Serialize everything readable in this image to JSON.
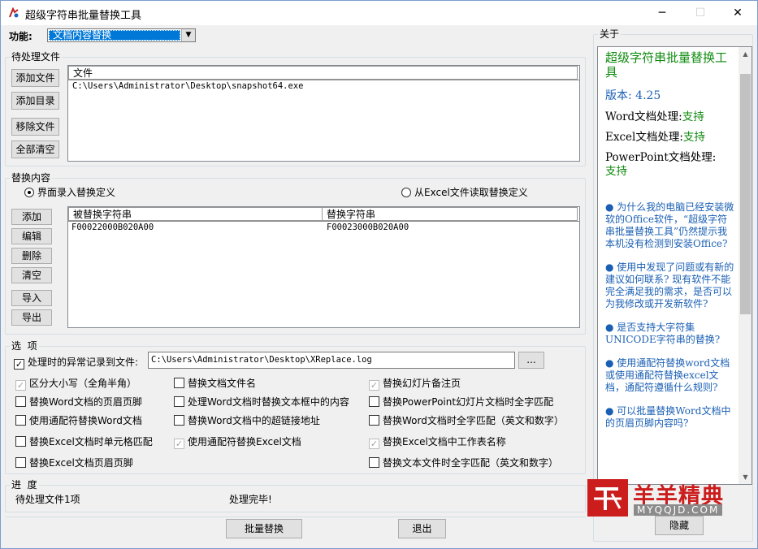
{
  "window": {
    "title": "超级字符串批量替换工具"
  },
  "function": {
    "label": "功能:",
    "selected": "文档内容替换"
  },
  "pending": {
    "group_label": "待处理文件",
    "buttons": [
      "添加文件",
      "添加目录",
      "移除文件",
      "全部清空"
    ],
    "column": "文件",
    "files": [
      "C:\\Users\\Administrator\\Desktop\\snapshot64.exe"
    ]
  },
  "replace": {
    "group_label": "替换内容",
    "radio_ui": "界面录入替换定义",
    "radio_excel": "从Excel文件读取替换定义",
    "buttons": [
      "添加",
      "编辑",
      "删除",
      "清空",
      "导入",
      "导出"
    ],
    "col_from": "被替换字符串",
    "col_to": "替换字符串",
    "rows": [
      {
        "from": "F00022000B020A00",
        "to": "F00023000B020A00"
      }
    ]
  },
  "options": {
    "group_label": "选  项",
    "log_label": "处理时的异常记录到文件:",
    "log_path": "C:\\Users\\Administrator\\Desktop\\XReplace.log",
    "browse": "...",
    "items": [
      {
        "label": "区分大小写（全角半角）",
        "checked": true,
        "disabled": true
      },
      {
        "label": "替换文档文件名",
        "checked": false,
        "disabled": false
      },
      {
        "label": "替换幻灯片备注页",
        "checked": true,
        "disabled": true
      },
      {
        "label": "替换Word文档的页眉页脚",
        "checked": false,
        "disabled": false
      },
      {
        "label": "处理Word文档时替换文本框中的内容",
        "checked": false,
        "disabled": false
      },
      {
        "label": "替换PowerPoint幻灯片文档时全字匹配",
        "checked": false,
        "disabled": false
      },
      {
        "label": "使用通配符替换Word文档",
        "checked": false,
        "disabled": false
      },
      {
        "label": "替换Word文档中的超链接地址",
        "checked": false,
        "disabled": false
      },
      {
        "label": "替换Word文档时全字匹配（英文和数字）",
        "checked": false,
        "disabled": false
      },
      {
        "label": "替换Excel文档时单元格匹配",
        "checked": false,
        "disabled": false
      },
      {
        "label": "使用通配符替换Excel文档",
        "checked": true,
        "disabled": true
      },
      {
        "label": "替换Excel文档中工作表名称",
        "checked": true,
        "disabled": true
      },
      {
        "label": "替换Excel文档页眉页脚",
        "checked": false,
        "disabled": false
      },
      {
        "label": "替换文本文件时全字匹配（英文和数字）",
        "checked": false,
        "disabled": false
      }
    ]
  },
  "progress": {
    "group_label": "进  度",
    "pending_text": "待处理文件1项",
    "status_text": "处理完毕!"
  },
  "actions": {
    "run": "批量替换",
    "exit": "退出"
  },
  "about": {
    "group_label": "关于",
    "app_name": "超级字符串批量替换工具",
    "version": "版本: 4.25",
    "features": [
      {
        "label": "Word文档处理:",
        "value": "支持"
      },
      {
        "label": "Excel文档处理:",
        "value": "支持"
      },
      {
        "label": "PowerPoint文档处理:",
        "value": "支持"
      }
    ],
    "faq": [
      "● 为什么我的电脑已经安装微软的Office软件，“超级字符串批量替换工具”仍然提示我本机没有检测到安装Office?",
      "● 使用中发现了问题或有新的建议如何联系? 现有软件不能完全满足我的需求，是否可以为我修改或开发新软件?",
      "● 是否支持大字符集UNICODE字符串的替换?",
      "● 使用通配符替换word文档或使用通配符替换excel文档，通配符遵循什么规则?",
      "● 可以批量替换Word文档中的页眉页脚内容吗?"
    ],
    "hide": "隐藏"
  },
  "watermark": {
    "brand": "羊羊精典",
    "url": "MYQQJD.COM"
  },
  "colors": {
    "accent": "#0078d7",
    "green": "#0f8a0f",
    "link": "#1a5fb4",
    "watermark_red": "#cc1d1d"
  }
}
